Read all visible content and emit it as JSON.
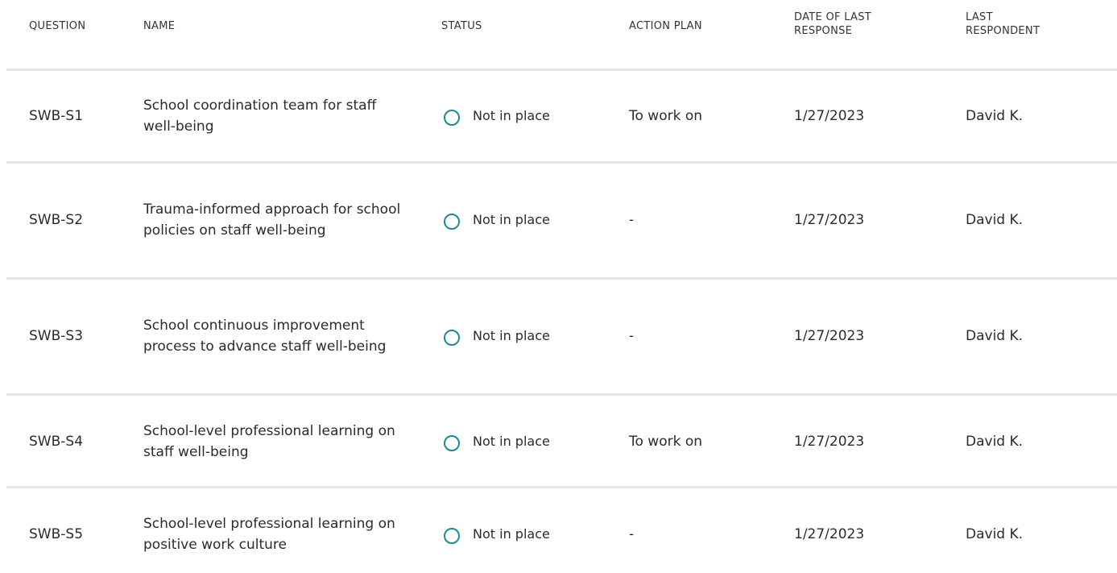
{
  "table": {
    "columns": {
      "question": "QUESTION",
      "name": "NAME",
      "status": "STATUS",
      "action_plan": "ACTION PLAN",
      "date_line1": "DATE OF LAST",
      "date_line2": "RESPONSE",
      "respondent_line1": "LAST",
      "respondent_line2": "RESPONDENT"
    },
    "rows": [
      {
        "question": "SWB-S1",
        "name": "School coordination team for staff well-being",
        "status": "Not in place",
        "action_plan": "To work on",
        "date": "1/27/2023",
        "respondent": "David K."
      },
      {
        "question": "SWB-S2",
        "name": "Trauma-informed approach for school policies on staff well-being",
        "status": "Not in place",
        "action_plan": "-",
        "date": "1/27/2023",
        "respondent": "David K."
      },
      {
        "question": "SWB-S3",
        "name": "School continuous improvement process to advance staff well-being",
        "status": "Not in place",
        "action_plan": "-",
        "date": "1/27/2023",
        "respondent": "David K."
      },
      {
        "question": "SWB-S4",
        "name": "School-level professional learning on staff well-being",
        "status": "Not in place",
        "action_plan": "To work on",
        "date": "1/27/2023",
        "respondent": "David K."
      },
      {
        "question": "SWB-S5",
        "name": "School-level professional learning on positive work culture",
        "status": "Not in place",
        "action_plan": "-",
        "date": "1/27/2023",
        "respondent": "David K."
      }
    ]
  },
  "colors": {
    "status_ring": "#1f8a93",
    "divider": "#e6e6e6",
    "text": "#2b2b2b"
  },
  "icons": {
    "status": "empty-circle-icon"
  }
}
